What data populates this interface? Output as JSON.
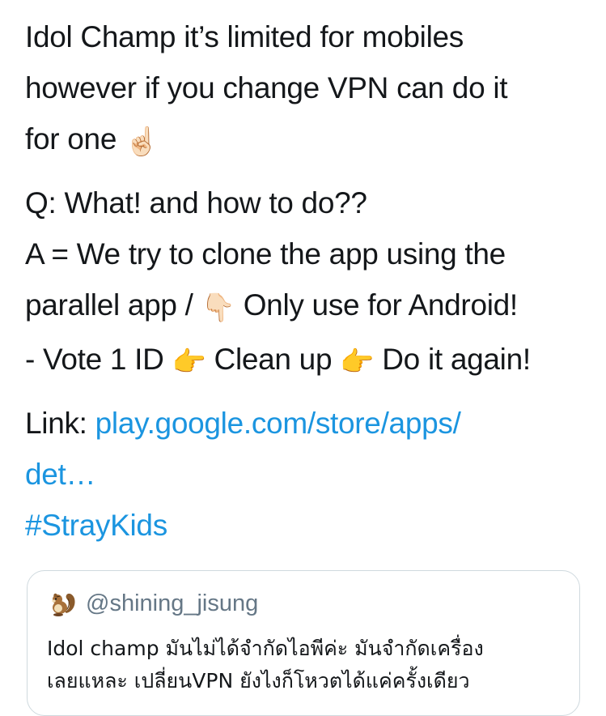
{
  "tweet": {
    "p1": {
      "line1": "Idol Champ it’s limited for mobiles",
      "line2": "however if you change VPN can do it",
      "line3": "for one",
      "line3_emoji": "☝🏻"
    },
    "p2": {
      "q": "Q: What! and how to do??",
      "a_line1": "A = We try to clone the app using the",
      "a_line2_pre": "parallel app /",
      "a_line2_emoji": "👇🏻",
      "a_line2_post": "Only use for Android!",
      "steps_pre": "- Vote 1 ID",
      "steps_emoji1": "👉",
      "steps_mid": "Clean up",
      "steps_emoji2": "👉",
      "steps_post": "Do it again!"
    },
    "p3": {
      "link_label": "Link:",
      "link_line1": "play.google.com/store/apps/",
      "link_line2": "det…",
      "hashtag": "#StrayKids"
    }
  },
  "quote": {
    "avatar_emoji": "🐿️",
    "handle": "@shining_jisung",
    "text_line1": "Idol champ มันไม่ได้จำกัดไอพีค่ะ มันจำกัดเครื่อง",
    "text_line2": "เลยแหละ เปลี่ยนVPN ยังไงก็โหวตได้แค่ครั้งเดียว"
  },
  "colors": {
    "text": "#14171a",
    "link": "#1b95e0",
    "secondary": "#657786",
    "border": "#cfd9de"
  }
}
